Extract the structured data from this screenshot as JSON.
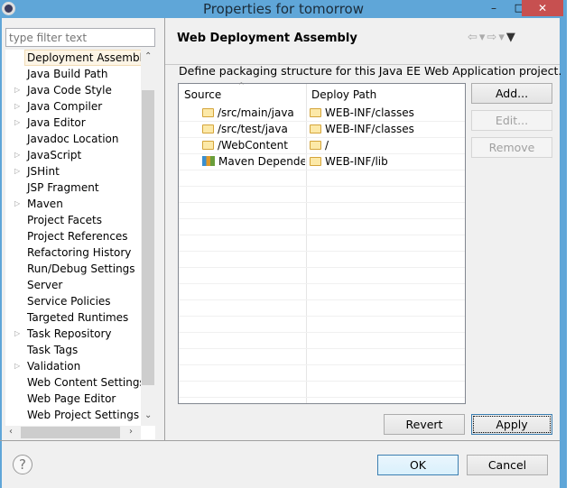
{
  "window": {
    "title": "Properties for tomorrow",
    "minimize": "–",
    "maximize": "□",
    "close": "✕"
  },
  "filter": {
    "placeholder": "type filter text",
    "value": ""
  },
  "tree": {
    "items": [
      {
        "label": "Deployment Assembly",
        "expandable": false,
        "selected": true
      },
      {
        "label": "Java Build Path",
        "expandable": false
      },
      {
        "label": "Java Code Style",
        "expandable": true
      },
      {
        "label": "Java Compiler",
        "expandable": true
      },
      {
        "label": "Java Editor",
        "expandable": true
      },
      {
        "label": "Javadoc Location",
        "expandable": false
      },
      {
        "label": "JavaScript",
        "expandable": true
      },
      {
        "label": "JSHint",
        "expandable": true
      },
      {
        "label": "JSP Fragment",
        "expandable": false
      },
      {
        "label": "Maven",
        "expandable": true
      },
      {
        "label": "Project Facets",
        "expandable": false
      },
      {
        "label": "Project References",
        "expandable": false
      },
      {
        "label": "Refactoring History",
        "expandable": false
      },
      {
        "label": "Run/Debug Settings",
        "expandable": false
      },
      {
        "label": "Server",
        "expandable": false
      },
      {
        "label": "Service Policies",
        "expandable": false
      },
      {
        "label": "Targeted Runtimes",
        "expandable": false
      },
      {
        "label": "Task Repository",
        "expandable": true
      },
      {
        "label": "Task Tags",
        "expandable": false
      },
      {
        "label": "Validation",
        "expandable": true
      },
      {
        "label": "Web Content Settings",
        "expandable": false
      },
      {
        "label": "Web Page Editor",
        "expandable": false
      },
      {
        "label": "Web Project Settings",
        "expandable": false
      }
    ]
  },
  "page": {
    "title": "Web Deployment Assembly",
    "description": "Define packaging structure for this Java EE Web Application project.",
    "table": {
      "columns": [
        "Source",
        "Deploy Path"
      ],
      "rows": [
        {
          "source": "/src/main/java",
          "source_icon": "folder-icon",
          "deploy": "WEB-INF/classes"
        },
        {
          "source": "/src/test/java",
          "source_icon": "folder-icon",
          "deploy": "WEB-INF/classes"
        },
        {
          "source": "/WebContent",
          "source_icon": "folder-icon",
          "deploy": "/"
        },
        {
          "source": "Maven Depende",
          "source_icon": "library-icon",
          "deploy": "WEB-INF/lib"
        }
      ]
    },
    "buttons": {
      "add": "Add...",
      "edit": "Edit...",
      "remove": "Remove",
      "revert": "Revert",
      "apply": "Apply"
    }
  },
  "footer": {
    "help": "?",
    "ok": "OK",
    "cancel": "Cancel"
  }
}
